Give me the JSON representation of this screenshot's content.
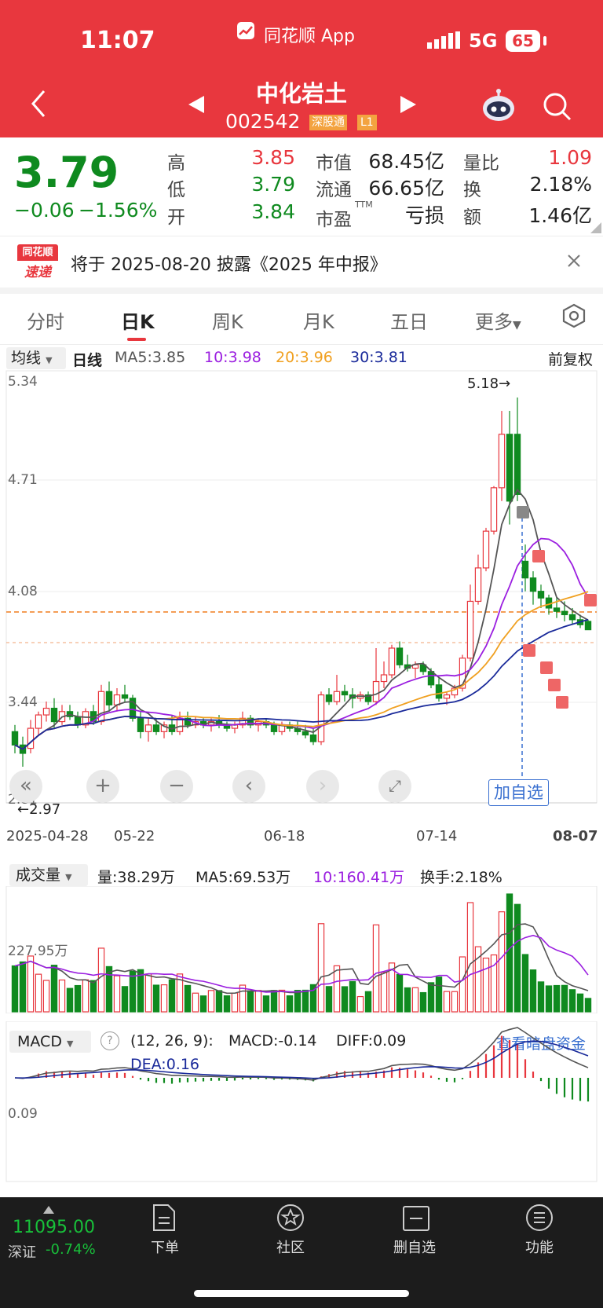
{
  "status": {
    "time": "11:07",
    "app": "同花顺 App",
    "network": "5G",
    "battery": "65"
  },
  "stock": {
    "name": "中化岩土",
    "code": "002542",
    "badge1": "深股通",
    "badge2": "L1"
  },
  "quote": {
    "price": "3.79",
    "change": "−0.06",
    "pct": "−1.56%",
    "high_label": "高",
    "high": "3.85",
    "low_label": "低",
    "low": "3.79",
    "open_label": "开",
    "open": "3.84",
    "mcap_label": "市值",
    "mcap": "68.45亿",
    "float_label": "流通",
    "float": "66.65亿",
    "pe_label": "市盈",
    "pe_sup": "TTM",
    "pe": "亏损",
    "vr_label": "量比",
    "vr": "1.09",
    "turn_label": "换",
    "turn": "2.18%",
    "amt_label": "额",
    "amt": "1.46亿"
  },
  "notice": {
    "logo_top": "同花顺",
    "logo_bottom": "速递",
    "text": "将于 2025-08-20 披露《2025 年中报》"
  },
  "tabs": [
    "分时",
    "日K",
    "周K",
    "月K",
    "五日",
    "更多"
  ],
  "kline": {
    "ma_selector": "均线",
    "period": "日线",
    "ma5": "MA5:3.85",
    "ma10": "10:3.98",
    "ma20": "20:3.96",
    "ma30": "30:3.81",
    "adjust": "前复权",
    "y_labels": [
      "5.34",
      "4.71",
      "4.08",
      "3.44",
      "2.81"
    ],
    "high_mark": "5.18→",
    "low_mark": "←2.97",
    "dates": [
      "2025-04-28",
      "05-22",
      "06-18",
      "07-14",
      "08-07"
    ],
    "add_watch": "加自选"
  },
  "volume": {
    "selector": "成交量",
    "vol": "量:38.29万",
    "ma5": "MA5:69.53万",
    "ma10": "10:160.41万",
    "turnover": "换手:2.18%",
    "y_label": "227.95万"
  },
  "macd": {
    "selector": "MACD",
    "params": "(12, 26, 9):",
    "macd": "MACD:-0.14",
    "diff": "DIFF:0.09",
    "dea": "DEA:0.16",
    "link": "查看暗盘资金",
    "y_label": "0.09"
  },
  "bottom": {
    "index_value": "11095.00",
    "index_name": "深证",
    "index_change": "-0.74%",
    "items": [
      "下单",
      "社区",
      "删自选",
      "功能"
    ]
  },
  "colors": {
    "up": "#e8373e",
    "down": "#0f8a1f",
    "ma5": "#555555",
    "ma10": "#9b1fe0",
    "ma20": "#f0a020",
    "ma30": "#1a2a9a"
  },
  "chart_data": {
    "type": "candlestick",
    "title": "中化岩土 日K",
    "ylim": [
      2.81,
      5.34
    ],
    "ticks": [
      "2025-04-28",
      "05-22",
      "06-18",
      "07-14",
      "08-07"
    ],
    "candles": [
      {
        "o": 3.18,
        "h": 3.22,
        "l": 3.05,
        "c": 3.1
      },
      {
        "o": 3.1,
        "h": 3.15,
        "l": 2.97,
        "c": 3.05
      },
      {
        "o": 3.08,
        "h": 3.25,
        "l": 3.05,
        "c": 3.2
      },
      {
        "o": 3.2,
        "h": 3.3,
        "l": 3.16,
        "c": 3.28
      },
      {
        "o": 3.28,
        "h": 3.36,
        "l": 3.24,
        "c": 3.32
      },
      {
        "o": 3.32,
        "h": 3.38,
        "l": 3.2,
        "c": 3.24
      },
      {
        "o": 3.24,
        "h": 3.34,
        "l": 3.22,
        "c": 3.3
      },
      {
        "o": 3.3,
        "h": 3.34,
        "l": 3.25,
        "c": 3.27
      },
      {
        "o": 3.27,
        "h": 3.3,
        "l": 3.2,
        "c": 3.22
      },
      {
        "o": 3.22,
        "h": 3.32,
        "l": 3.2,
        "c": 3.3
      },
      {
        "o": 3.3,
        "h": 3.34,
        "l": 3.22,
        "c": 3.24
      },
      {
        "o": 3.24,
        "h": 3.46,
        "l": 3.22,
        "c": 3.42
      },
      {
        "o": 3.42,
        "h": 3.48,
        "l": 3.3,
        "c": 3.34
      },
      {
        "o": 3.34,
        "h": 3.44,
        "l": 3.3,
        "c": 3.4
      },
      {
        "o": 3.4,
        "h": 3.46,
        "l": 3.36,
        "c": 3.38
      },
      {
        "o": 3.38,
        "h": 3.4,
        "l": 3.24,
        "c": 3.26
      },
      {
        "o": 3.26,
        "h": 3.3,
        "l": 3.14,
        "c": 3.18
      },
      {
        "o": 3.18,
        "h": 3.26,
        "l": 3.12,
        "c": 3.22
      },
      {
        "o": 3.22,
        "h": 3.26,
        "l": 3.16,
        "c": 3.18
      },
      {
        "o": 3.18,
        "h": 3.24,
        "l": 3.14,
        "c": 3.22
      },
      {
        "o": 3.22,
        "h": 3.28,
        "l": 3.16,
        "c": 3.18
      },
      {
        "o": 3.18,
        "h": 3.3,
        "l": 3.16,
        "c": 3.26
      },
      {
        "o": 3.26,
        "h": 3.3,
        "l": 3.2,
        "c": 3.22
      },
      {
        "o": 3.22,
        "h": 3.27,
        "l": 3.2,
        "c": 3.24
      },
      {
        "o": 3.24,
        "h": 3.26,
        "l": 3.2,
        "c": 3.22
      },
      {
        "o": 3.22,
        "h": 3.26,
        "l": 3.18,
        "c": 3.24
      },
      {
        "o": 3.24,
        "h": 3.28,
        "l": 3.2,
        "c": 3.22
      },
      {
        "o": 3.22,
        "h": 3.24,
        "l": 3.18,
        "c": 3.2
      },
      {
        "o": 3.2,
        "h": 3.24,
        "l": 3.17,
        "c": 3.22
      },
      {
        "o": 3.22,
        "h": 3.3,
        "l": 3.2,
        "c": 3.26
      },
      {
        "o": 3.26,
        "h": 3.28,
        "l": 3.2,
        "c": 3.22
      },
      {
        "o": 3.22,
        "h": 3.26,
        "l": 3.18,
        "c": 3.24
      },
      {
        "o": 3.24,
        "h": 3.26,
        "l": 3.2,
        "c": 3.22
      },
      {
        "o": 3.22,
        "h": 3.24,
        "l": 3.16,
        "c": 3.18
      },
      {
        "o": 3.18,
        "h": 3.24,
        "l": 3.16,
        "c": 3.22
      },
      {
        "o": 3.22,
        "h": 3.24,
        "l": 3.18,
        "c": 3.2
      },
      {
        "o": 3.2,
        "h": 3.24,
        "l": 3.16,
        "c": 3.18
      },
      {
        "o": 3.18,
        "h": 3.22,
        "l": 3.14,
        "c": 3.16
      },
      {
        "o": 3.16,
        "h": 3.2,
        "l": 3.1,
        "c": 3.12
      },
      {
        "o": 3.12,
        "h": 3.42,
        "l": 3.1,
        "c": 3.4
      },
      {
        "o": 3.4,
        "h": 3.44,
        "l": 3.34,
        "c": 3.36
      },
      {
        "o": 3.36,
        "h": 3.52,
        "l": 3.34,
        "c": 3.42
      },
      {
        "o": 3.42,
        "h": 3.46,
        "l": 3.36,
        "c": 3.4
      },
      {
        "o": 3.4,
        "h": 3.44,
        "l": 3.32,
        "c": 3.38
      },
      {
        "o": 3.38,
        "h": 3.42,
        "l": 3.36,
        "c": 3.4
      },
      {
        "o": 3.4,
        "h": 3.42,
        "l": 3.34,
        "c": 3.36
      },
      {
        "o": 3.36,
        "h": 3.68,
        "l": 3.34,
        "c": 3.48
      },
      {
        "o": 3.48,
        "h": 3.6,
        "l": 3.44,
        "c": 3.52
      },
      {
        "o": 3.52,
        "h": 3.7,
        "l": 3.5,
        "c": 3.68
      },
      {
        "o": 3.68,
        "h": 3.72,
        "l": 3.56,
        "c": 3.58
      },
      {
        "o": 3.58,
        "h": 3.64,
        "l": 3.54,
        "c": 3.56
      },
      {
        "o": 3.56,
        "h": 3.6,
        "l": 3.5,
        "c": 3.58
      },
      {
        "o": 3.58,
        "h": 3.6,
        "l": 3.52,
        "c": 3.54
      },
      {
        "o": 3.54,
        "h": 3.56,
        "l": 3.44,
        "c": 3.46
      },
      {
        "o": 3.46,
        "h": 3.5,
        "l": 3.36,
        "c": 3.38
      },
      {
        "o": 3.38,
        "h": 3.42,
        "l": 3.34,
        "c": 3.4
      },
      {
        "o": 3.4,
        "h": 3.46,
        "l": 3.38,
        "c": 3.44
      },
      {
        "o": 3.44,
        "h": 3.64,
        "l": 3.42,
        "c": 3.62
      },
      {
        "o": 3.62,
        "h": 4.06,
        "l": 3.6,
        "c": 3.96
      },
      {
        "o": 3.96,
        "h": 4.24,
        "l": 3.94,
        "c": 4.16
      },
      {
        "o": 4.16,
        "h": 4.4,
        "l": 4.14,
        "c": 4.38
      },
      {
        "o": 4.38,
        "h": 4.65,
        "l": 4.36,
        "c": 4.64
      },
      {
        "o": 4.64,
        "h": 5.1,
        "l": 4.56,
        "c": 4.96
      },
      {
        "o": 4.96,
        "h": 5.1,
        "l": 4.42,
        "c": 4.56
      },
      {
        "o": 4.96,
        "h": 5.18,
        "l": 4.56,
        "c": 4.6
      },
      {
        "o": 4.2,
        "h": 4.3,
        "l": 4.02,
        "c": 4.1
      },
      {
        "o": 4.1,
        "h": 4.14,
        "l": 3.94,
        "c": 4.02
      },
      {
        "o": 4.02,
        "h": 4.06,
        "l": 3.92,
        "c": 3.98
      },
      {
        "o": 3.98,
        "h": 4.0,
        "l": 3.88,
        "c": 3.92
      },
      {
        "o": 3.92,
        "h": 3.98,
        "l": 3.86,
        "c": 3.9
      },
      {
        "o": 3.9,
        "h": 3.96,
        "l": 3.84,
        "c": 3.88
      },
      {
        "o": 3.88,
        "h": 3.92,
        "l": 3.82,
        "c": 3.85
      },
      {
        "o": 3.85,
        "h": 3.88,
        "l": 3.8,
        "c": 3.82
      },
      {
        "o": 3.84,
        "h": 3.85,
        "l": 3.79,
        "c": 3.79
      }
    ]
  }
}
